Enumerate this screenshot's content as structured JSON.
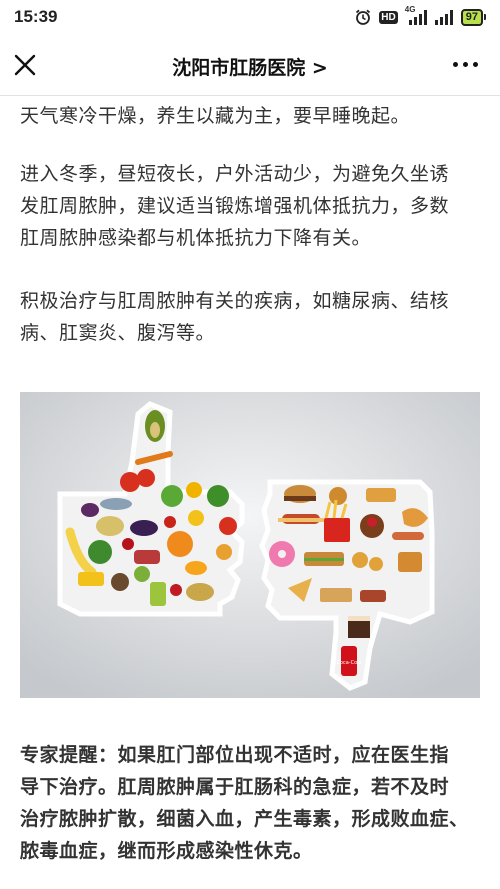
{
  "status_bar": {
    "time": "15:39",
    "signal_label": "4G",
    "hd_label": "HD",
    "battery": "97",
    "icons": [
      "alarm-icon",
      "hd-icon",
      "signal-4g-icon",
      "signal-icon",
      "battery-icon"
    ]
  },
  "nav": {
    "title": "沈阳市肛肠医院 >",
    "close_icon": "close-icon",
    "more_icon": "more-icon"
  },
  "article": {
    "para1": "天气寒冷干燥，养生以藏为主，要早睡晚起。",
    "para2_lines": [
      "进入冬季，昼短夜长，户外活动少，为避免久坐诱",
      "发肛周脓肿，建议适当锻炼增强机体抵抗力，多数",
      "肛周脓肿感染都与机体抵抗力下降有关。"
    ],
    "para3_lines": [
      "积极治疗与肛周脓肿有关的疾病，如糖尿病、结核",
      "病、肛窦炎、腹泻等。"
    ],
    "para4_lines": [
      "专家提醒：如果肛门部位出现不适时，应在医生指",
      "导下治疗。肛周脓肿属于肛肠科的急症，若不及时",
      "治疗脓肿扩散，细菌入血，产生毒素，形成败血症、",
      "脓毒血症，继而形成感染性休克。"
    ]
  },
  "image": {
    "description_icon": "thumbs-up-healthy-food-thumbs-down-junk-food-image",
    "can_label": "Coca-Cola"
  }
}
